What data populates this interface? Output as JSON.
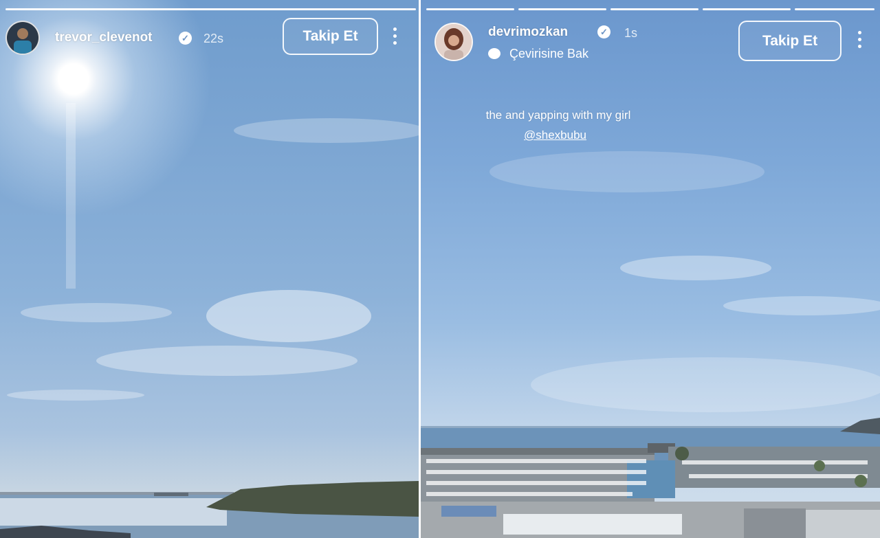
{
  "stories": [
    {
      "username": "trevor_clevenot",
      "verified": true,
      "time_ago": "22s",
      "follow_label": "Takip Et",
      "progress_segments": 1,
      "progress_current": 1
    },
    {
      "username": "devrimozkan",
      "verified": true,
      "time_ago": "1s",
      "follow_label": "Takip Et",
      "translate_label": "Çevirisine Bak",
      "caption": "the and yapping with my girl",
      "mention": "@shexbubu",
      "progress_segments": 5,
      "progress_current": 5
    }
  ],
  "icons": {
    "verified": "verified-badge-icon",
    "menu": "more-options-icon",
    "translate": "translate-bubble-icon"
  },
  "colors": {
    "sky_top": "#6f9ccd",
    "sea": "#6f93b7",
    "text": "#ffffff"
  }
}
